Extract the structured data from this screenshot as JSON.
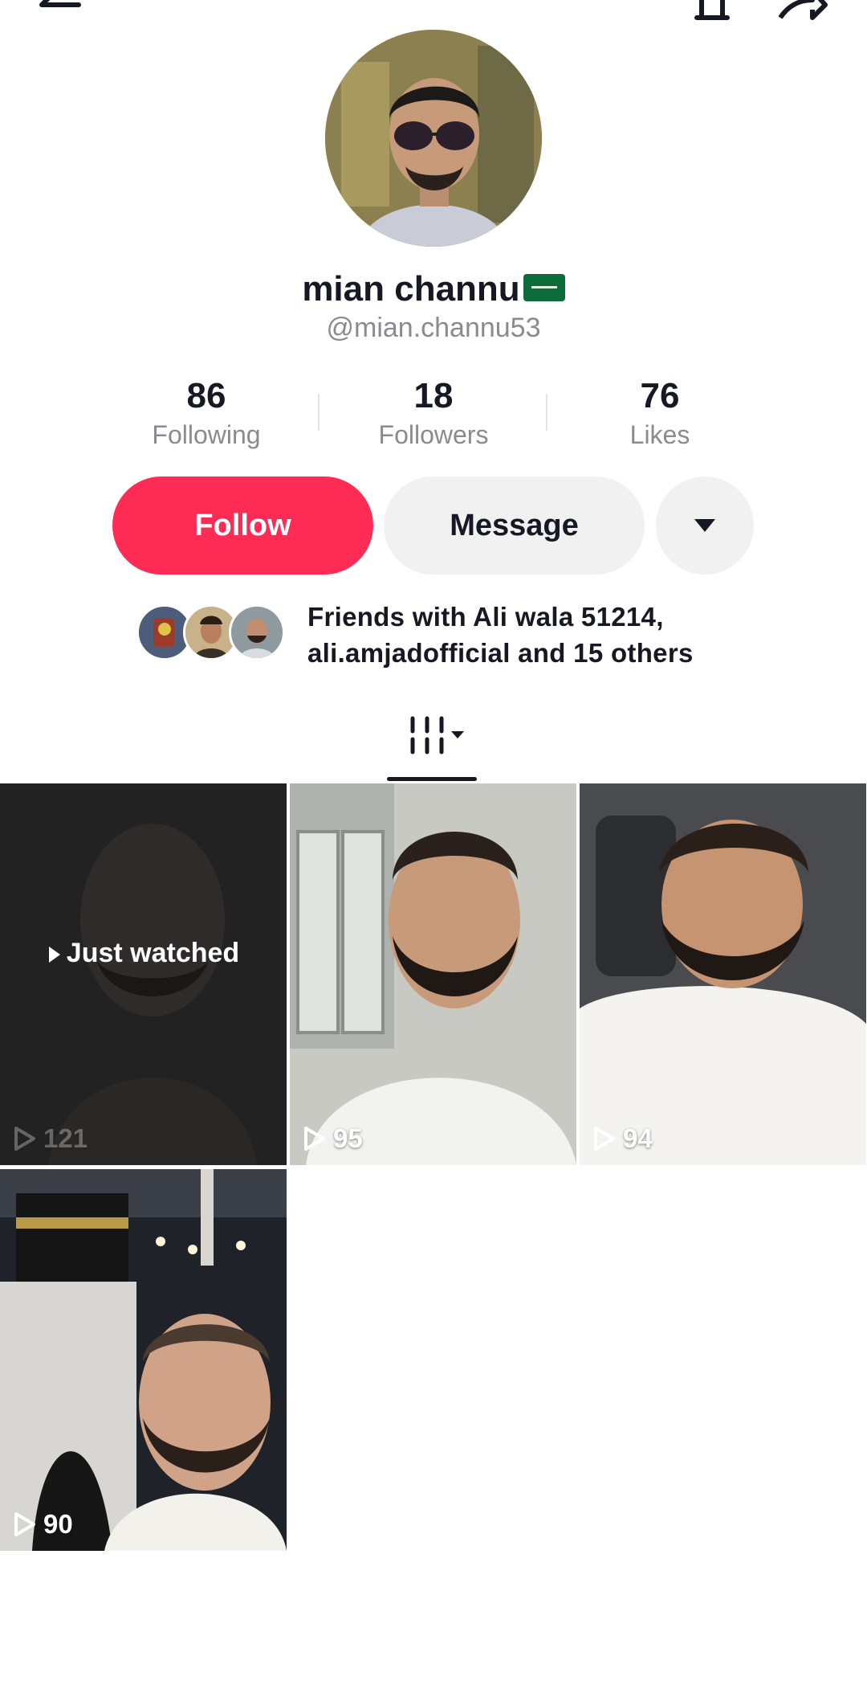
{
  "profile": {
    "display_name": "mian channu",
    "handle": "@mian.channu53"
  },
  "stats": [
    {
      "value": "86",
      "label": "Following"
    },
    {
      "value": "18",
      "label": "Followers"
    },
    {
      "value": "76",
      "label": "Likes"
    }
  ],
  "actions": {
    "follow_label": "Follow",
    "message_label": "Message"
  },
  "friends": {
    "line1": "Friends with Ali wala 51214,",
    "line2": "ali.amjadofficial and 15 others"
  },
  "videos": [
    {
      "views": "121",
      "overlay": "Just watched"
    },
    {
      "views": "95"
    },
    {
      "views": "94"
    },
    {
      "views": "90"
    }
  ],
  "colors": {
    "accent": "#fe2c55",
    "secondary_button": "#f1f1f2",
    "muted_text": "#8a8b91"
  },
  "icons": {
    "back": "arrow-left-icon",
    "notifications": "bell-icon",
    "share": "share-arrow-icon",
    "more": "triangle-down-icon",
    "grid": "video-grid-icon",
    "play": "play-outline-icon"
  }
}
